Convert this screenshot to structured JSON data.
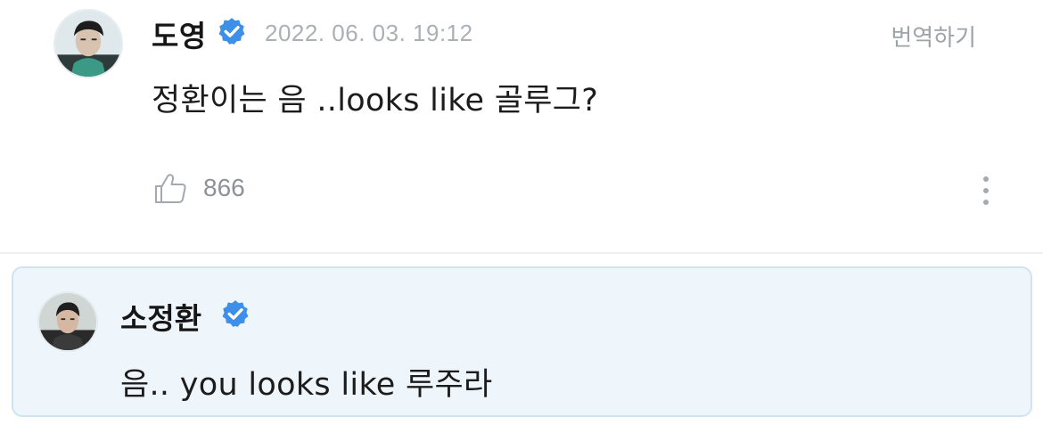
{
  "comment": {
    "author": "도영",
    "verified_icon": "verified-badge-icon",
    "timestamp": "2022. 06. 03. 19:12",
    "translate_label": "번역하기",
    "text": "정환이는 음 ..looks like 골루그?",
    "like_icon": "thumbs-up-icon",
    "like_count": "866",
    "more_icon": "more-vertical-icon"
  },
  "reply": {
    "author": "소정환",
    "verified_icon": "verified-badge-icon",
    "text": "음.. you looks like 루주라"
  },
  "colors": {
    "verified": "#3d8fe8",
    "reply_background": "#eef6fb",
    "reply_border": "#cfe4f1",
    "muted_text": "#aab0b5"
  }
}
